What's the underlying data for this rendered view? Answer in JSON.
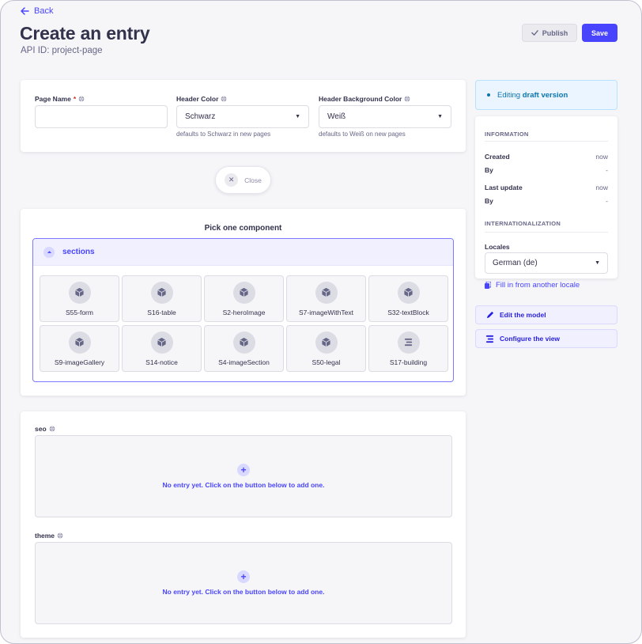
{
  "header": {
    "back_label": "Back",
    "title": "Create an entry",
    "api_id": "API ID: project-page",
    "publish_label": "Publish",
    "save_label": "Save"
  },
  "fields": {
    "page_name": {
      "label": "Page Name",
      "required_mark": "*",
      "value": ""
    },
    "header_color": {
      "label": "Header Color",
      "value": "Schwarz",
      "hint": "defaults to Schwarz in new pages"
    },
    "header_bg_color": {
      "label": "Header Background Color",
      "value": "Weiß",
      "hint": "defaults to Weiß on new pages"
    }
  },
  "close_label": "Close",
  "component_picker": {
    "title": "Pick one component",
    "category": "sections",
    "components": [
      {
        "label": "S55-form",
        "icon": "cube-icon"
      },
      {
        "label": "S16-table",
        "icon": "cube-icon"
      },
      {
        "label": "S2-heroImage",
        "icon": "cube-icon"
      },
      {
        "label": "S7-imageWithText",
        "icon": "cube-icon"
      },
      {
        "label": "S32-textBlock",
        "icon": "cube-icon"
      },
      {
        "label": "S9-imageGallery",
        "icon": "cube-icon"
      },
      {
        "label": "S14-notice",
        "icon": "cube-icon"
      },
      {
        "label": "S4-imageSection",
        "icon": "cube-icon"
      },
      {
        "label": "S50-legal",
        "icon": "cube-icon"
      },
      {
        "label": "S17-building",
        "icon": "list-icon"
      }
    ]
  },
  "dynamic_zones": [
    {
      "label": "seo",
      "empty_text": "No entry yet. Click on the button below to add one."
    },
    {
      "label": "theme",
      "empty_text": "No entry yet. Click on the button below to add one."
    }
  ],
  "sidebar": {
    "draft_prefix": "Editing",
    "draft_strong": "draft version",
    "information_heading": "INFORMATION",
    "created_label": "Created",
    "created_value": "now",
    "created_by_label": "By",
    "created_by_value": "-",
    "updated_label": "Last update",
    "updated_value": "now",
    "updated_by_label": "By",
    "updated_by_value": "-",
    "i18n_heading": "INTERNATIONALIZATION",
    "locales_label": "Locales",
    "locale_value": "German (de)",
    "fill_locale_label": "Fill in from another locale",
    "edit_model_label": "Edit the model",
    "configure_view_label": "Configure the view"
  },
  "colors": {
    "primary": "#4945ff",
    "background": "#f6f6f9",
    "draft_bg": "#eaf5ff",
    "draft_text": "#0c75af"
  }
}
